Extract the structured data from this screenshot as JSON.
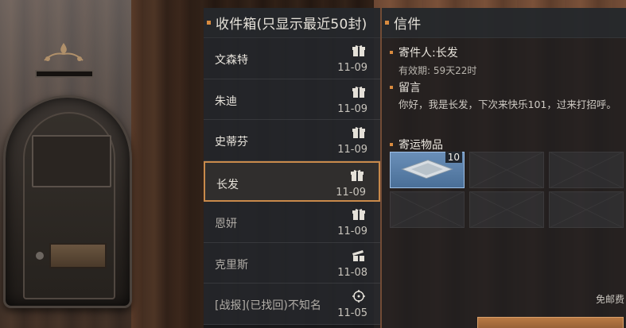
{
  "inbox": {
    "title": "收件箱(只显示最近50封)",
    "items": [
      {
        "sender": "文森特",
        "date": "11-09",
        "icon": "gift-icon",
        "selected": false,
        "read": false
      },
      {
        "sender": "朱迪",
        "date": "11-09",
        "icon": "gift-icon",
        "selected": false,
        "read": false
      },
      {
        "sender": "史蒂芬",
        "date": "11-09",
        "icon": "gift-icon",
        "selected": false,
        "read": false
      },
      {
        "sender": "长发",
        "date": "11-09",
        "icon": "gift-icon",
        "selected": true,
        "read": false
      },
      {
        "sender": "恩妍",
        "date": "11-09",
        "icon": "gift-icon",
        "selected": false,
        "read": true
      },
      {
        "sender": "克里斯",
        "date": "11-08",
        "icon": "opened-gift-icon",
        "selected": false,
        "read": true
      },
      {
        "sender": "[战报](已找回)不知名",
        "date": "11-05",
        "icon": "target-icon",
        "selected": false,
        "read": true
      }
    ]
  },
  "letter": {
    "title": "信件",
    "sender_label": "寄件人:长发",
    "validity": "有效期: 59天22时",
    "message_label": "留言",
    "message": "你好，我是长发，下次来快乐101，过来打招呼。",
    "items_label": "寄运物品",
    "item_quantity": "10",
    "postage": "免邮费"
  },
  "colors": {
    "accent": "#d98b3f",
    "selected_border": "#c98a4b",
    "item_slot_blue": "#5a80aa"
  }
}
